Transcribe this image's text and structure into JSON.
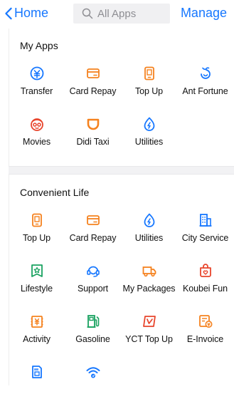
{
  "header": {
    "back_label": "Home",
    "search_placeholder": "All Apps",
    "manage_label": "Manage"
  },
  "colors": {
    "accent": "#1677ff",
    "orange": "#f5821f",
    "red": "#e8452c",
    "green": "#1aa260",
    "blue": "#1677ff"
  },
  "my_apps": {
    "title": "My Apps",
    "items": [
      {
        "label": "Transfer",
        "icon": "transfer-icon"
      },
      {
        "label": "Card Repay",
        "icon": "card-repay-icon"
      },
      {
        "label": "Top Up",
        "icon": "top-up-icon"
      },
      {
        "label": "Ant Fortune",
        "icon": "ant-fortune-icon"
      },
      {
        "label": "Movies",
        "icon": "movies-icon"
      },
      {
        "label": "Didi Taxi",
        "icon": "didi-taxi-icon"
      },
      {
        "label": "Utilities",
        "icon": "utilities-icon"
      }
    ]
  },
  "convenient_life": {
    "title": "Convenient Life",
    "items": [
      {
        "label": "Top Up",
        "icon": "top-up-icon"
      },
      {
        "label": "Card Repay",
        "icon": "card-repay-icon"
      },
      {
        "label": "Utilities",
        "icon": "utilities-icon"
      },
      {
        "label": "City Service",
        "icon": "city-service-icon"
      },
      {
        "label": "Lifestyle",
        "icon": "lifestyle-icon"
      },
      {
        "label": "Support",
        "icon": "support-icon"
      },
      {
        "label": "My Packages",
        "icon": "packages-icon"
      },
      {
        "label": "Koubei Fun",
        "icon": "koubei-fun-icon"
      },
      {
        "label": "Activity",
        "icon": "activity-icon"
      },
      {
        "label": "Gasoline",
        "icon": "gasoline-icon"
      },
      {
        "label": "YCT Top Up",
        "icon": "yct-top-up-icon"
      },
      {
        "label": "E-Invoice",
        "icon": "e-invoice-icon"
      },
      {
        "label": "",
        "icon": "sim-card-icon"
      },
      {
        "label": "",
        "icon": "wifi-icon"
      }
    ]
  }
}
